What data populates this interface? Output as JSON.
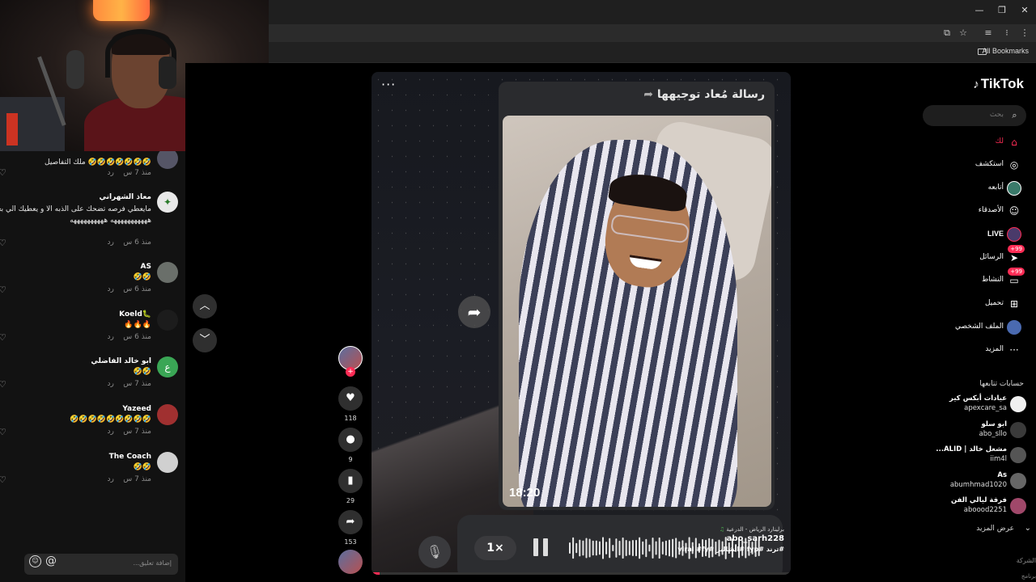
{
  "browser": {
    "bookmarks_label": "All Bookmarks",
    "icons": [
      "install-icon",
      "star-icon",
      "media-icon",
      "extension-icon",
      "menu-icon"
    ],
    "window_buttons": [
      "—",
      "❐",
      "✕"
    ]
  },
  "chat": {
    "comments": [
      {
        "name": "",
        "text": "🤣🤣🤣🤣🤣🤣🤣 ملك التفاصيل",
        "time": "منذ 7 س",
        "reply": "رد",
        "avatar_color": "#556"
      },
      {
        "name": "معاذ الشهراني",
        "text": "مايعطي فرصه تضحك على الذبه الا و يعطيك الي بعدها هههههههههههه ههههههههههه",
        "time": "منذ 6 س",
        "reply": "رد",
        "avatar_color": "#e8e8e8"
      },
      {
        "name": "AS",
        "text": "🤣🤣",
        "time": "منذ 6 س",
        "reply": "رد",
        "avatar_color": "#6a6f6a"
      },
      {
        "name": "Koeld🐛",
        "text": "🔥🔥🔥",
        "time": "منذ 6 س",
        "reply": "رد",
        "avatar_color": "#1c1c1c"
      },
      {
        "name": "ابو خالد الفاضلي",
        "text": "🤣🤣",
        "time": "منذ 7 س",
        "reply": "رد",
        "avatar_color": "#3aa655",
        "initial": "ع"
      },
      {
        "name": "Yazeed",
        "text": "🤣🤣🤣🤣🤣🤣🤣🤣🤣",
        "time": "منذ 7 س",
        "reply": "رد",
        "avatar_color": "#a03030"
      },
      {
        "name": "The Coach",
        "text": "🤣🤣",
        "time": "منذ 7 س",
        "reply": "رد",
        "avatar_color": "#d0d0d0"
      }
    ],
    "input_placeholder": "إضافة تعليق...",
    "emoji_icon": "☺",
    "mention_icon": "@"
  },
  "video": {
    "card_title": "رسالة مُعاد توجيهها",
    "time_overlay": "18:20",
    "speed": "1×",
    "music": "برلينارد الرياض - الدرعية",
    "author": "abo_sarh228",
    "hashtags": "#ترند #fyp #الشاليز #viral #fy",
    "progress_percent": 2
  },
  "actions": {
    "likes": "118",
    "comments": "9",
    "saves": "29",
    "shares": "153"
  },
  "sidebar": {
    "logo": "TikTok",
    "search_placeholder": "بحث",
    "nav": [
      {
        "label": "لك",
        "icon": "⌂",
        "color": "#fe2c55"
      },
      {
        "label": "استكشف",
        "icon": "◎",
        "color": "#fff"
      },
      {
        "label": "أتابعه",
        "icon": "●",
        "color": "#fff"
      },
      {
        "label": "الأصدقاء",
        "icon": "☺",
        "color": "#fff"
      },
      {
        "label": "LIVE",
        "icon": "●",
        "color": "#fff"
      },
      {
        "label": "الرسائل",
        "icon": "➤",
        "color": "#fff",
        "badge": "+99"
      },
      {
        "label": "النشاط",
        "icon": "▭",
        "color": "#fff",
        "badge": "+99"
      },
      {
        "label": "تحميل",
        "icon": "⊞",
        "color": "#fff"
      },
      {
        "label": "الملف الشخصي",
        "icon": "●",
        "color": "#fff"
      },
      {
        "label": "المزيد",
        "icon": "···",
        "color": "#fff"
      }
    ],
    "following_heading": "حسابات تتابعها",
    "accounts": [
      {
        "name": "عيادات أبكس كير",
        "handle": "apexcare_sa",
        "color": "#f0f0f0"
      },
      {
        "name": "ابو سلو",
        "handle": "abo_sllo",
        "color": "#3a3a3a"
      },
      {
        "name": "مشعل خالد | ALID...",
        "handle": "iim4l",
        "color": "#555"
      },
      {
        "name": "As",
        "handle": "abumhmad1020",
        "color": "#666"
      },
      {
        "name": "فرقة ليالي الفن",
        "handle": "aboood2251",
        "color": "#a0486a"
      }
    ],
    "see_more": "عرض المزيد",
    "company": "الشركة",
    "program": "برنامج"
  }
}
